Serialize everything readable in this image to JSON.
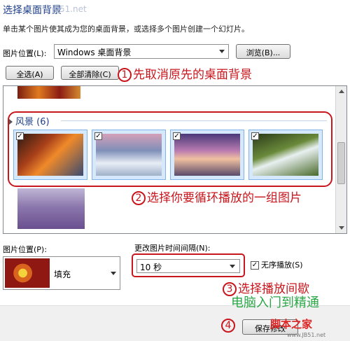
{
  "window": {
    "title": "选择桌面背景",
    "watermark_top": "jb51.net",
    "description": "单击某个图片使其成为您的桌面背景，或选择多个图片创建一个幻灯片。"
  },
  "picture_location": {
    "label": "图片位置(L):",
    "value": "Windows 桌面背景",
    "browse_label": "浏览(B)..."
  },
  "buttons": {
    "select_all": "全选(A)",
    "clear_all": "全部清除(C)",
    "save": "保存修改"
  },
  "gallery": {
    "group_name": "风景 (6)",
    "tiles": [
      {
        "checked": "✓",
        "subject": "canyon"
      },
      {
        "checked": "✓",
        "subject": "snowy-lake"
      },
      {
        "checked": "✓",
        "subject": "rocky-shore"
      },
      {
        "checked": "✓",
        "subject": "waterfall"
      }
    ]
  },
  "picture_position": {
    "label": "图片位置(P):",
    "value": "填充"
  },
  "interval": {
    "label": "更改图片时间间隔(N):",
    "value": "10 秒"
  },
  "shuffle": {
    "label": "无序播放(S)",
    "checked": "✓"
  },
  "annotations": [
    {
      "num": "1",
      "text": "先取消原先的桌面背景"
    },
    {
      "num": "2",
      "text": "选择你要循环播放的一组图片"
    },
    {
      "num": "3",
      "text": "选择播放间歇"
    },
    {
      "num": "4",
      "text": ""
    }
  ],
  "watermarks": {
    "brand": "电脑入门到精通",
    "site": "脚本之家",
    "url": "www.JB51.net"
  },
  "colors": {
    "annotation_red": "#c8161d",
    "title_blue": "#1e3f8a",
    "brand_green": "#28a745"
  }
}
